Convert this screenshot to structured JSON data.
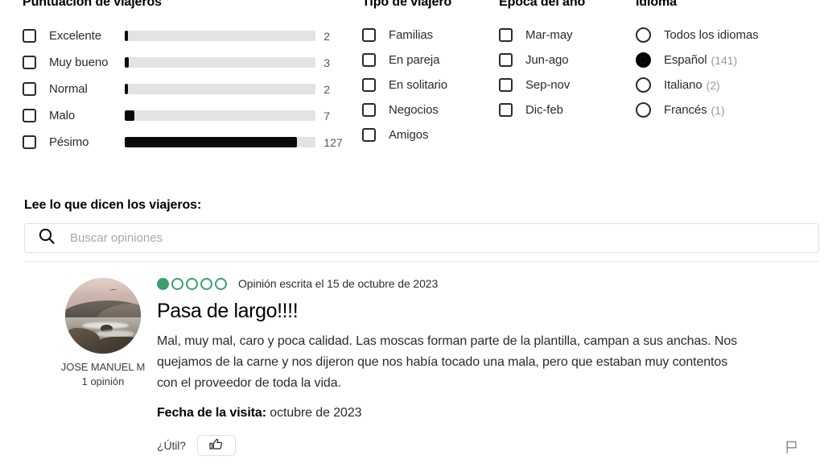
{
  "filters": {
    "rating": {
      "title": "Puntuación de viajeros",
      "items": [
        {
          "label": "Excelente",
          "count": "2",
          "pct": 1.5
        },
        {
          "label": "Muy bueno",
          "count": "3",
          "pct": 2.2
        },
        {
          "label": "Normal",
          "count": "2",
          "pct": 1.5
        },
        {
          "label": "Malo",
          "count": "7",
          "pct": 5.1
        },
        {
          "label": "Pésimo",
          "count": "127",
          "pct": 90.0
        }
      ]
    },
    "traveler": {
      "title": "Tipo de viajero",
      "items": [
        {
          "label": "Familias"
        },
        {
          "label": "En pareja"
        },
        {
          "label": "En solitario"
        },
        {
          "label": "Negocios"
        },
        {
          "label": "Amigos"
        }
      ]
    },
    "season": {
      "title": "Época del año",
      "items": [
        {
          "label": "Mar-may"
        },
        {
          "label": "Jun-ago"
        },
        {
          "label": "Sep-nov"
        },
        {
          "label": "Dic-feb"
        }
      ]
    },
    "language": {
      "title": "Idioma",
      "items": [
        {
          "label": "Todos los idiomas",
          "count": "",
          "selected": false
        },
        {
          "label": "Español",
          "count": "(141)",
          "selected": true
        },
        {
          "label": "Italiano",
          "count": "(2)",
          "selected": false
        },
        {
          "label": "Francés",
          "count": "(1)",
          "selected": false
        }
      ]
    }
  },
  "reviews_section": {
    "heading": "Lee lo que dicen los viajeros:",
    "search_placeholder": "Buscar opiniones",
    "search_value": ""
  },
  "review": {
    "author": "JOSE MANUEL M",
    "author_meta": "1 opinión",
    "rating": 1,
    "rating_max": 5,
    "date_text": "Opinión escrita el 15 de octubre de 2023",
    "title": "Pasa de largo!!!!",
    "text": "Mal, muy mal, caro y poca calidad. Las moscas forman parte de la plantilla, campan a sus anchas. Nos quejamos de la carne y nos dijeron que nos había tocado una mala, pero que estaban muy contentos con el proveedor de toda la vida.",
    "visit_label": "Fecha de la visita:",
    "visit_value": "octubre de 2023",
    "useful_label": "¿Útil?"
  },
  "colors": {
    "bubble_green": "#3aa06c",
    "bar_fill": "#0a0a0a",
    "bar_track": "#e3e3e3"
  }
}
